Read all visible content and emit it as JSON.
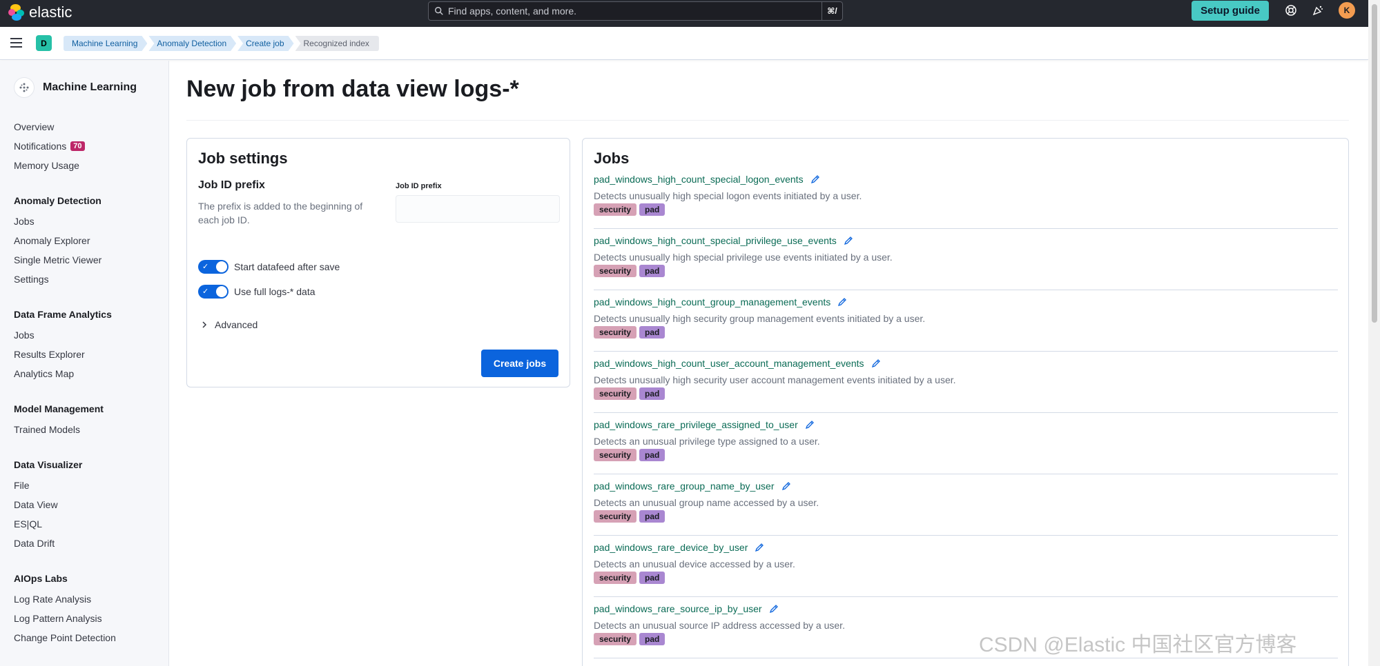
{
  "header": {
    "brand": "elastic",
    "search_placeholder": "Find apps, content, and more.",
    "search_shortcut": "⌘/",
    "setup_guide": "Setup guide",
    "avatar_initial": "K"
  },
  "breadcrumb": {
    "space": "D",
    "items": [
      "Machine Learning",
      "Anomaly Detection",
      "Create job",
      "Recognized index"
    ]
  },
  "sidebar": {
    "title": "Machine Learning",
    "top_items": [
      "Overview",
      "Notifications",
      "Memory Usage"
    ],
    "notifications_count": "70",
    "groups": [
      {
        "title": "Anomaly Detection",
        "items": [
          "Jobs",
          "Anomaly Explorer",
          "Single Metric Viewer",
          "Settings"
        ]
      },
      {
        "title": "Data Frame Analytics",
        "items": [
          "Jobs",
          "Results Explorer",
          "Analytics Map"
        ]
      },
      {
        "title": "Model Management",
        "items": [
          "Trained Models"
        ]
      },
      {
        "title": "Data Visualizer",
        "items": [
          "File",
          "Data View",
          "ES|QL",
          "Data Drift"
        ]
      },
      {
        "title": "AIOps Labs",
        "items": [
          "Log Rate Analysis",
          "Log Pattern Analysis",
          "Change Point Detection"
        ]
      }
    ]
  },
  "page": {
    "title": "New job from data view logs-*"
  },
  "job_settings": {
    "title": "Job settings",
    "prefix_title": "Job ID prefix",
    "prefix_desc": "The prefix is added to the beginning of each job ID.",
    "prefix_label": "Job ID prefix",
    "prefix_value": "",
    "toggle_start": "Start datafeed after save",
    "toggle_full": "Use full logs-* data",
    "advanced": "Advanced",
    "create_button": "Create jobs"
  },
  "jobs": {
    "title": "Jobs",
    "items": [
      {
        "name": "pad_windows_high_count_special_logon_events",
        "desc": "Detects unusually high special logon events initiated by a user.",
        "tags": [
          "security",
          "pad"
        ]
      },
      {
        "name": "pad_windows_high_count_special_privilege_use_events",
        "desc": "Detects unusually high special privilege use events initiated by a user.",
        "tags": [
          "security",
          "pad"
        ]
      },
      {
        "name": "pad_windows_high_count_group_management_events",
        "desc": "Detects unusually high security group management events initiated by a user.",
        "tags": [
          "security",
          "pad"
        ]
      },
      {
        "name": "pad_windows_high_count_user_account_management_events",
        "desc": "Detects unusually high security user account management events initiated by a user.",
        "tags": [
          "security",
          "pad"
        ]
      },
      {
        "name": "pad_windows_rare_privilege_assigned_to_user",
        "desc": "Detects an unusual privilege type assigned to a user.",
        "tags": [
          "security",
          "pad"
        ]
      },
      {
        "name": "pad_windows_rare_group_name_by_user",
        "desc": "Detects an unusual group name accessed by a user.",
        "tags": [
          "security",
          "pad"
        ]
      },
      {
        "name": "pad_windows_rare_device_by_user",
        "desc": "Detects an unusual device accessed by a user.",
        "tags": [
          "security",
          "pad"
        ]
      },
      {
        "name": "pad_windows_rare_source_ip_by_user",
        "desc": "Detects an unusual source IP address accessed by a user.",
        "tags": [
          "security",
          "pad"
        ]
      }
    ]
  },
  "watermark": "CSDN @Elastic 中国社区官方博客",
  "colors": {
    "header_bg": "#25282f",
    "accent": "#0b64dd",
    "setup_button": "#48c9c4",
    "job_link": "#0a6b55",
    "tag_security": "#d6a1b5",
    "tag_pad": "#a987d1",
    "notification_badge": "#bd2768"
  }
}
